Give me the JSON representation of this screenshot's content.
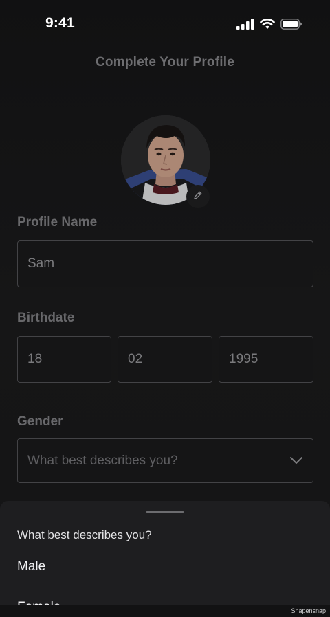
{
  "status_bar": {
    "time": "9:41",
    "icons": [
      "cellular-signal-icon",
      "wifi-icon",
      "battery-icon"
    ]
  },
  "page": {
    "title": "Complete Your Profile"
  },
  "profile": {
    "avatar_icon": "profile-photo",
    "edit_icon": "pencil-icon",
    "name_label": "Profile Name",
    "name_value": "Sam",
    "birthdate_label": "Birthdate",
    "birth_day": "18",
    "birth_month": "02",
    "birth_year": "1995",
    "gender_label": "Gender",
    "gender_placeholder": "What best describes you?",
    "gender_icon": "chevron-down-icon"
  },
  "sheet": {
    "title": "What best describes you?",
    "options": [
      "Male",
      "Female"
    ]
  },
  "watermark": "Snapensnap",
  "colors": {
    "background": "#111112",
    "sheet": "#1e1e20",
    "label": "#68686b",
    "border": "#434346"
  }
}
